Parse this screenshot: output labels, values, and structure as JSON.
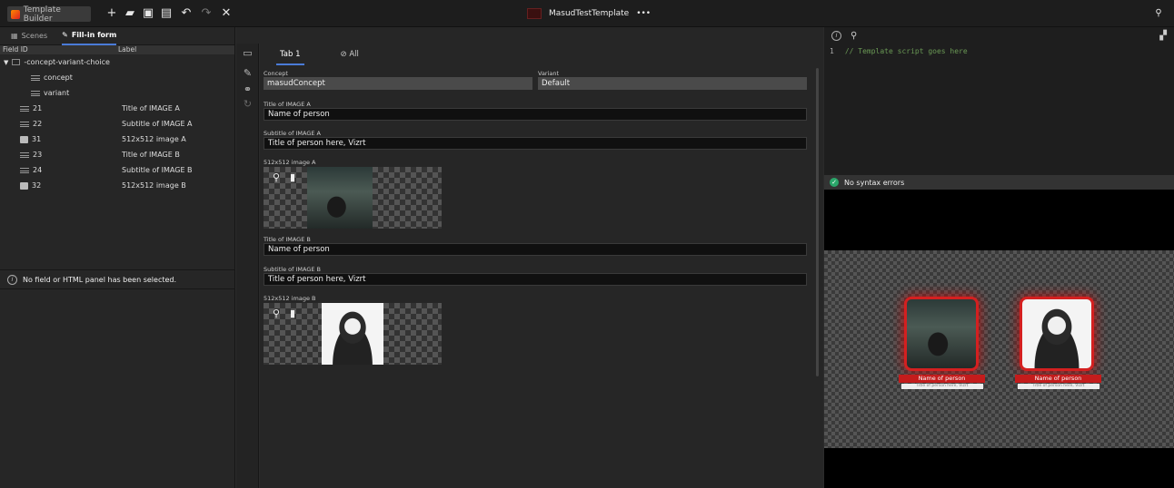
{
  "topbar": {
    "app_title": "Template Builder",
    "template_name": "MasudTestTemplate",
    "more": "•••"
  },
  "sidebar": {
    "tabs": [
      {
        "label": "Scenes"
      },
      {
        "label": "Fill-in form"
      }
    ],
    "columns": {
      "field_id": "Field ID",
      "label": "Label"
    },
    "rows": [
      {
        "id": "-concept-variant-choice",
        "label": "",
        "icon": "folder-icon"
      },
      {
        "id": "concept",
        "label": "",
        "icon": "lines-icon"
      },
      {
        "id": "variant",
        "label": "",
        "icon": "lines-icon"
      },
      {
        "id": "21",
        "label": "Title of IMAGE A",
        "icon": "lines-icon"
      },
      {
        "id": "22",
        "label": "Subtitle of IMAGE A",
        "icon": "lines-icon"
      },
      {
        "id": "31",
        "label": "512x512 image A",
        "icon": "image-icon"
      },
      {
        "id": "23",
        "label": "Title of IMAGE B",
        "icon": "lines-icon"
      },
      {
        "id": "24",
        "label": "Subtitle of IMAGE B",
        "icon": "lines-icon"
      },
      {
        "id": "32",
        "label": "512x512 image B",
        "icon": "image-icon"
      }
    ],
    "info_message": "No field or HTML panel has been selected."
  },
  "form": {
    "tabs": [
      {
        "label": "Tab 1"
      },
      {
        "label": "All"
      }
    ],
    "concept": {
      "label": "Concept",
      "value": "masudConcept"
    },
    "variant": {
      "label": "Variant",
      "value": "Default"
    },
    "title_a": {
      "label": "Title of IMAGE A",
      "value": "Name of person"
    },
    "subtitle_a": {
      "label": "Subtitle of IMAGE A",
      "value": "Title of person here, Vizrt"
    },
    "image_a": {
      "label": "512x512 image A"
    },
    "title_b": {
      "label": "Title of IMAGE B",
      "value": "Name of person"
    },
    "subtitle_b": {
      "label": "Subtitle of IMAGE B",
      "value": "Title of person here, Vizrt"
    },
    "image_b": {
      "label": "512x512 image B"
    }
  },
  "script": {
    "line_number": "1",
    "code": "// Template script goes here",
    "status": "No syntax errors"
  },
  "preview": {
    "card_a": {
      "name": "Name of person",
      "subtitle": "Title of person here, Vizrt"
    },
    "card_b": {
      "name": "Name of person",
      "subtitle": "Title of person here, Vizrt"
    }
  },
  "colors": {
    "accent": "#4a7bd8",
    "brand_red": "#d42020",
    "ok_green": "#2aa66a"
  }
}
